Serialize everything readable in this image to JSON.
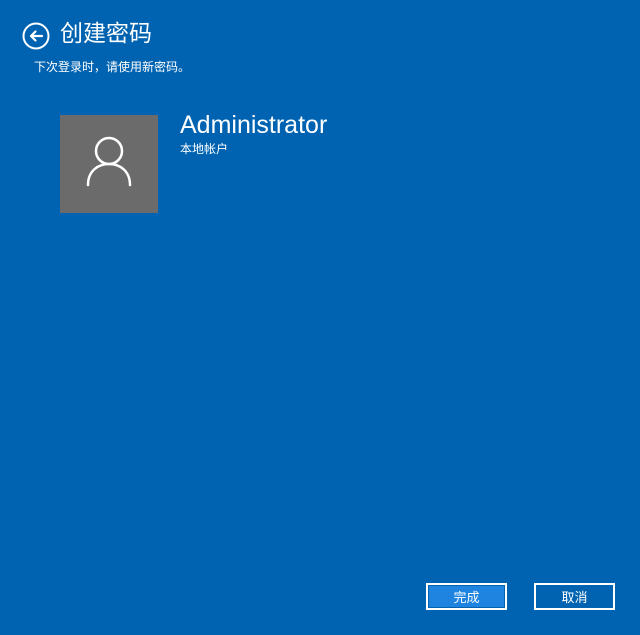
{
  "header": {
    "title": "创建密码",
    "subtitle": "下次登录时，请使用新密码。",
    "back_icon": "back-arrow-circle-icon"
  },
  "account": {
    "username": "Administrator",
    "account_type": "本地帐户",
    "avatar_icon": "user-icon"
  },
  "buttons": {
    "finish_label": "完成",
    "cancel_label": "取消"
  },
  "colors": {
    "background": "#0063b1",
    "avatar_background": "#6b6b6b",
    "primary_button": "#1e84e0",
    "text": "#ffffff"
  }
}
